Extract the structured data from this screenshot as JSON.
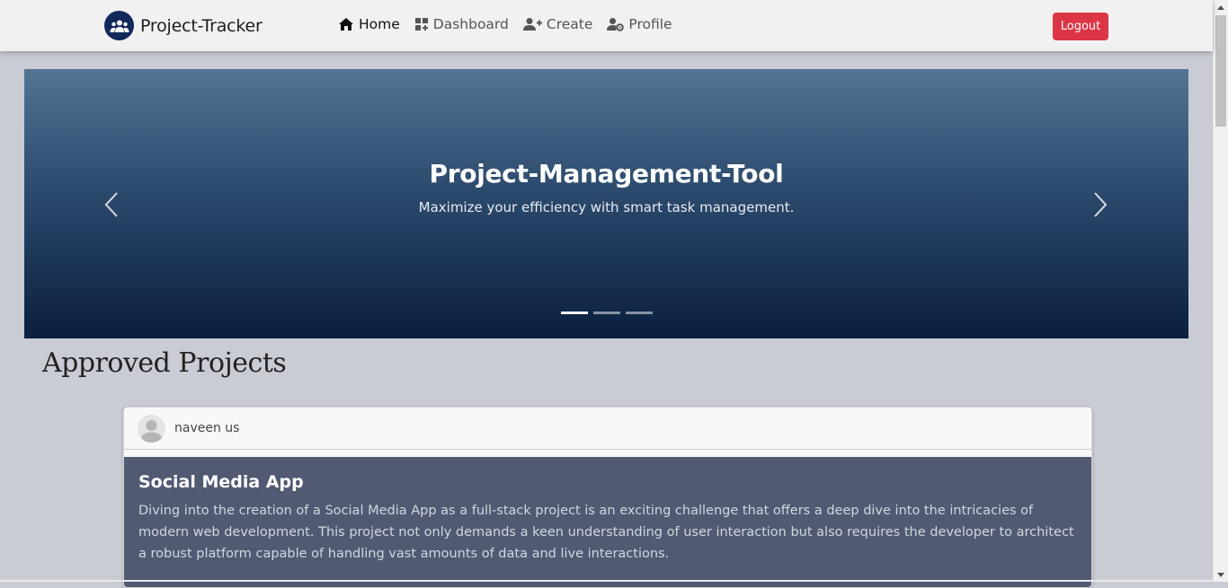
{
  "navbar": {
    "brand": "Project-Tracker",
    "links": [
      {
        "label": "Home",
        "icon": "home-icon",
        "active": true
      },
      {
        "label": "Dashboard",
        "icon": "dashboard-icon",
        "active": false
      },
      {
        "label": "Create",
        "icon": "user-plus-icon",
        "active": false
      },
      {
        "label": "Profile",
        "icon": "user-gear-icon",
        "active": false
      }
    ],
    "logout_label": "Logout"
  },
  "carousel": {
    "title": "Project-Management-Tool",
    "subtitle": "Maximize your efficiency with smart task management.",
    "slide_count": 3,
    "active_slide": 1
  },
  "section": {
    "title": "Approved Projects"
  },
  "projects": [
    {
      "author": "naveen us",
      "title": "Social Media App",
      "description": "Diving into the creation of a Social Media App as a full-stack project is an exciting challenge that offers a deep dive into the intricacies of modern web development. This project not only demands a keen understanding of user interaction but also requires the developer to architect a robust platform capable of handling vast amounts of data and live interactions."
    }
  ],
  "colors": {
    "logout": "#dc3545",
    "brand_logo": "#12285a",
    "card_body": "#515a72",
    "page_background": "#c9ccd4"
  }
}
